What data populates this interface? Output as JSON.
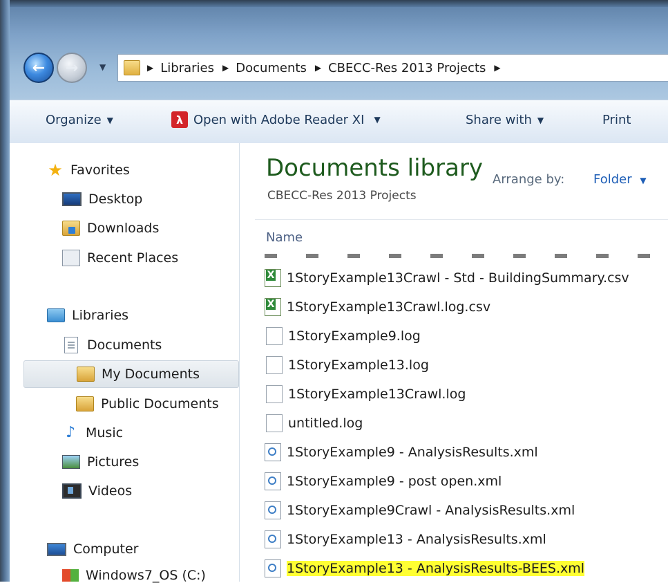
{
  "address": {
    "crumbs": [
      "Libraries",
      "Documents",
      "CBECC-Res 2013 Projects"
    ]
  },
  "toolbar": {
    "organize": "Organize",
    "open_with": "Open with Adobe Reader XI",
    "share_with": "Share with",
    "print": "Print"
  },
  "navpane": {
    "favorites": "Favorites",
    "desktop": "Desktop",
    "downloads": "Downloads",
    "recent": "Recent Places",
    "libraries": "Libraries",
    "documents": "Documents",
    "my_documents": "My Documents",
    "public_documents": "Public Documents",
    "music": "Music",
    "pictures": "Pictures",
    "videos": "Videos",
    "computer": "Computer",
    "drive": "Windows7_OS (C:)"
  },
  "content": {
    "title": "Documents library",
    "subtitle": "CBECC-Res 2013 Projects",
    "arrange_label": "Arrange by:",
    "arrange_value": "Folder",
    "column_name": "Name",
    "files": [
      "1StoryExample13Crawl - Std - BuildingSummary.csv",
      "1StoryExample13Crawl.log.csv",
      "1StoryExample9.log",
      "1StoryExample13.log",
      "1StoryExample13Crawl.log",
      "untitled.log",
      "1StoryExample9 - AnalysisResults.xml",
      "1StoryExample9 - post open.xml",
      "1StoryExample9Crawl - AnalysisResults.xml",
      "1StoryExample13 - AnalysisResults.xml",
      "1StoryExample13 - AnalysisResults-BEES.xml"
    ]
  },
  "colors": {
    "highlight": "#ffff33",
    "library_title": "#1e5b1e",
    "link_blue": "#1f5fb7"
  }
}
